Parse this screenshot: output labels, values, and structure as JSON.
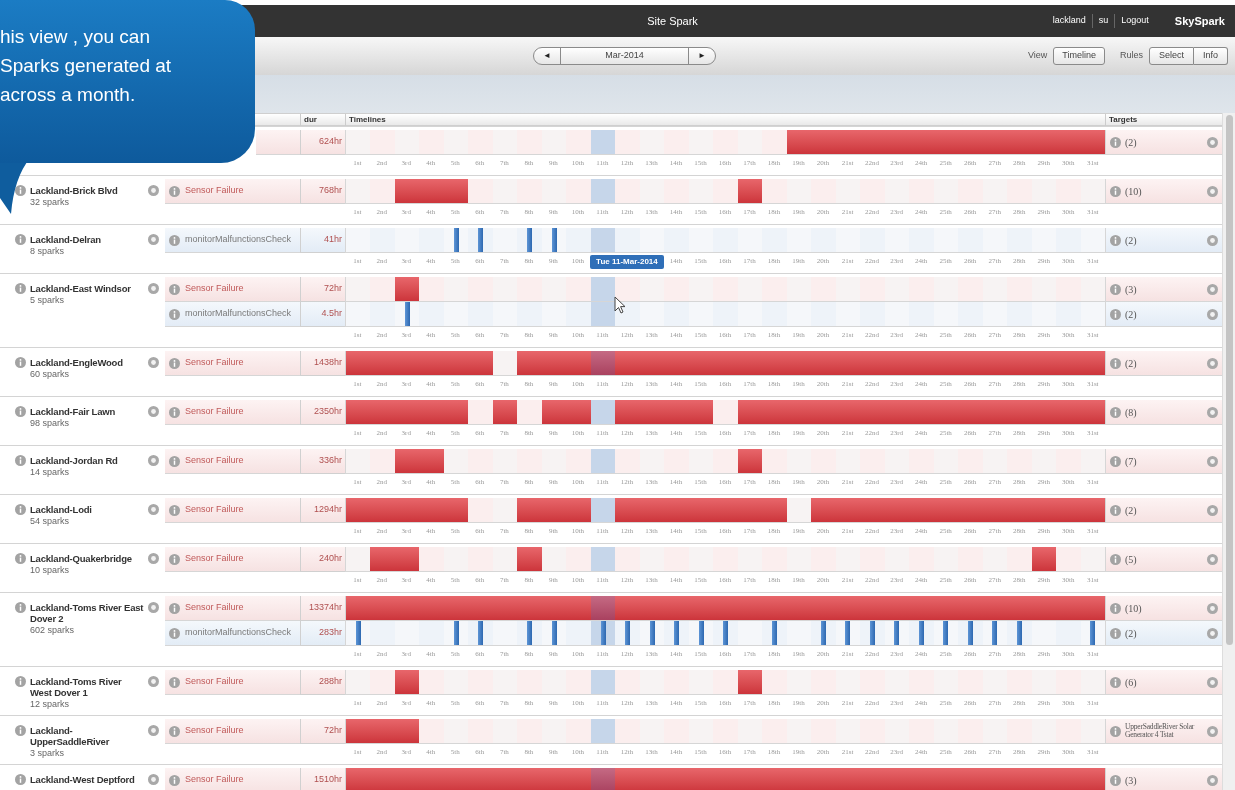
{
  "callout": {
    "lines": [
      "his view , you can",
      "Sparks generated at",
      "across a month."
    ]
  },
  "window": {
    "title": "Site Spark"
  },
  "user_links": [
    "lackland",
    "su",
    "Logout"
  ],
  "brand": "SkySpark",
  "month_nav": {
    "prev": "◄",
    "month": "Mar-2014",
    "next": "►"
  },
  "view": {
    "label": "View",
    "button": "Timeline"
  },
  "rules": {
    "label": "Rules",
    "buttons": [
      "Select",
      "Info"
    ]
  },
  "table": {
    "columns": [
      "dur",
      "Timelines",
      "Targets"
    ],
    "days": [
      {
        "selected": false
      },
      {
        "selected": false
      },
      {
        "selected": false
      },
      {
        "selected": false
      },
      {
        "selected": false
      },
      {
        "selected": false
      },
      {
        "selected": false
      },
      {
        "selected": false
      },
      {
        "selected": false
      },
      {
        "selected": false
      },
      {
        "selected": true
      },
      {
        "selected": false
      },
      {
        "selected": false
      },
      {
        "selected": false
      },
      {
        "selected": false
      },
      {
        "selected": false
      },
      {
        "selected": false
      },
      {
        "selected": false
      },
      {
        "selected": false
      },
      {
        "selected": false
      },
      {
        "selected": false
      },
      {
        "selected": false
      },
      {
        "selected": false
      },
      {
        "selected": false
      },
      {
        "selected": false
      },
      {
        "selected": false
      },
      {
        "selected": false
      },
      {
        "selected": false
      },
      {
        "selected": false
      },
      {
        "selected": false
      },
      {
        "selected": false
      }
    ],
    "groups": [
      {
        "rules": [
          {
            "kind": "failure",
            "dur": "624hr",
            "target": "(2)",
            "days": [
              false,
              false,
              false,
              false,
              false,
              false,
              false,
              false,
              false,
              false,
              false,
              false,
              false,
              false,
              false,
              false,
              false,
              false,
              true,
              true,
              true,
              true,
              true,
              true,
              true,
              true,
              true,
              true,
              true,
              true,
              true
            ]
          }
        ],
        "labels": [
          "1st",
          "2nd",
          "3rd",
          "4th",
          "5th",
          "6th",
          "7th",
          "8th",
          "9th",
          "10th",
          "11th",
          "12th",
          "13th",
          "14th",
          "15th",
          "16th",
          "17th",
          "18th",
          "19th",
          "20th",
          "21st",
          "22nd",
          "23rd",
          "24th",
          "25th",
          "26th",
          "27th",
          "28th",
          "29th",
          "30th",
          "31st"
        ]
      },
      {
        "site": {
          "name": "Lackland-Brick Blvd",
          "sparks": "32 sparks"
        },
        "rules": [
          {
            "kind": "failure",
            "name": "Sensor Failure",
            "dur": "768hr",
            "target": "(10)",
            "days": [
              false,
              false,
              true,
              true,
              true,
              false,
              false,
              false,
              false,
              false,
              false,
              false,
              false,
              false,
              false,
              false,
              true,
              false,
              false,
              false,
              false,
              false,
              false,
              false,
              false,
              false,
              false,
              false,
              false,
              false,
              false
            ]
          }
        ],
        "labels": [
          "1st",
          "2nd",
          "3rd",
          "4th",
          "5th",
          "6th",
          "7th",
          "8th",
          "9th",
          "10th",
          "11th",
          "12th",
          "13th",
          "14th",
          "15th",
          "16th",
          "17th",
          "18th",
          "19th",
          "20th",
          "21st",
          "22nd",
          "23rd",
          "24th",
          "25th",
          "26th",
          "27th",
          "28th",
          "29th",
          "30th",
          "31st"
        ]
      },
      {
        "site": {
          "name": "Lackland-Delran",
          "sparks": "8 sparks"
        },
        "rules": [
          {
            "kind": "check",
            "name": "monitorMalfunctionsCheck",
            "dur": "41hr",
            "target": "(2)",
            "days": [
              false,
              false,
              false,
              false,
              true,
              true,
              false,
              true,
              true,
              false,
              false,
              false,
              false,
              false,
              false,
              false,
              false,
              false,
              false,
              false,
              false,
              false,
              false,
              false,
              false,
              false,
              false,
              false,
              false,
              false,
              false
            ]
          }
        ],
        "labels_before": [
          "1st",
          "2nd",
          "3rd",
          "4th",
          "5th",
          "6th",
          "7th",
          "8th",
          "9th",
          "10th"
        ],
        "tooltip": "Tue 11-Mar-2014",
        "labels_after": [
          "14th",
          "15th",
          "16th",
          "17th",
          "18th",
          "19th",
          "20th",
          "21st",
          "22nd",
          "23rd",
          "24th",
          "25th",
          "26th",
          "27th",
          "28th",
          "29th",
          "30th",
          "31st"
        ]
      },
      {
        "site": {
          "name": "Lackland-East Windsor",
          "sparks": "5 sparks"
        },
        "rules": [
          {
            "kind": "failure",
            "name": "Sensor Failure",
            "dur": "72hr",
            "target": "(3)",
            "days": [
              false,
              false,
              true,
              false,
              false,
              false,
              false,
              false,
              false,
              false,
              false,
              false,
              false,
              false,
              false,
              false,
              false,
              false,
              false,
              false,
              false,
              false,
              false,
              false,
              false,
              false,
              false,
              false,
              false,
              false,
              false
            ]
          },
          {
            "kind": "check",
            "name": "monitorMalfunctionsCheck",
            "dur": "4.5hr",
            "target": "(2)",
            "days": [
              false,
              false,
              true,
              false,
              false,
              false,
              false,
              false,
              false,
              false,
              false,
              false,
              false,
              false,
              false,
              false,
              false,
              false,
              false,
              false,
              false,
              false,
              false,
              false,
              false,
              false,
              false,
              false,
              false,
              false,
              false
            ]
          }
        ],
        "labels": [
          "1st",
          "2nd",
          "3rd",
          "4th",
          "5th",
          "6th",
          "7th",
          "8th",
          "9th",
          "10th",
          "11th",
          "12th",
          "13th",
          "14th",
          "15th",
          "16th",
          "17th",
          "18th",
          "19th",
          "20th",
          "21st",
          "22nd",
          "23rd",
          "24th",
          "25th",
          "26th",
          "27th",
          "28th",
          "29th",
          "30th",
          "31st"
        ]
      },
      {
        "site": {
          "name": "Lackland-EngleWood",
          "sparks": "60 sparks"
        },
        "rules": [
          {
            "kind": "failure",
            "name": "Sensor Failure",
            "dur": "1438hr",
            "target": "(2)",
            "days": [
              true,
              true,
              true,
              true,
              true,
              true,
              false,
              true,
              true,
              true,
              true,
              true,
              true,
              true,
              true,
              true,
              true,
              true,
              true,
              true,
              true,
              true,
              true,
              true,
              true,
              true,
              true,
              true,
              true,
              true,
              true
            ]
          }
        ],
        "labels": [
          "1st",
          "2nd",
          "3rd",
          "4th",
          "5th",
          "6th",
          "7th",
          "8th",
          "9th",
          "10th",
          "11th",
          "12th",
          "13th",
          "14th",
          "15th",
          "16th",
          "17th",
          "18th",
          "19th",
          "20th",
          "21st",
          "22nd",
          "23rd",
          "24th",
          "25th",
          "26th",
          "27th",
          "28th",
          "29th",
          "30th",
          "31st"
        ]
      },
      {
        "site": {
          "name": "Lackland-Fair Lawn",
          "sparks": "98 sparks"
        },
        "rules": [
          {
            "kind": "failure",
            "name": "Sensor Failure",
            "dur": "2350hr",
            "target": "(8)",
            "days": [
              true,
              true,
              true,
              true,
              true,
              false,
              true,
              false,
              true,
              true,
              false,
              true,
              true,
              true,
              true,
              false,
              true,
              true,
              true,
              true,
              true,
              true,
              true,
              true,
              true,
              true,
              true,
              true,
              true,
              true,
              true
            ]
          }
        ],
        "labels": [
          "1st",
          "2nd",
          "3rd",
          "4th",
          "5th",
          "6th",
          "7th",
          "8th",
          "9th",
          "10th",
          "11th",
          "12th",
          "13th",
          "14th",
          "15th",
          "16th",
          "17th",
          "18th",
          "19th",
          "20th",
          "21st",
          "22nd",
          "23rd",
          "24th",
          "25th",
          "26th",
          "27th",
          "28th",
          "29th",
          "30th",
          "31st"
        ]
      },
      {
        "site": {
          "name": "Lackland-Jordan Rd",
          "sparks": "14 sparks"
        },
        "rules": [
          {
            "kind": "failure",
            "name": "Sensor Failure",
            "dur": "336hr",
            "target": "(7)",
            "days": [
              false,
              false,
              true,
              true,
              false,
              false,
              false,
              false,
              false,
              false,
              false,
              false,
              false,
              false,
              false,
              false,
              true,
              false,
              false,
              false,
              false,
              false,
              false,
              false,
              false,
              false,
              false,
              false,
              false,
              false,
              false
            ]
          }
        ],
        "labels": [
          "1st",
          "2nd",
          "3rd",
          "4th",
          "5th",
          "6th",
          "7th",
          "8th",
          "9th",
          "10th",
          "11th",
          "12th",
          "13th",
          "14th",
          "15th",
          "16th",
          "17th",
          "18th",
          "19th",
          "20th",
          "21st",
          "22nd",
          "23rd",
          "24th",
          "25th",
          "26th",
          "27th",
          "28th",
          "29th",
          "30th",
          "31st"
        ]
      },
      {
        "site": {
          "name": "Lackland-Lodi",
          "sparks": "54 sparks"
        },
        "rules": [
          {
            "kind": "failure",
            "name": "Sensor Failure",
            "dur": "1294hr",
            "target": "(2)",
            "days": [
              true,
              true,
              true,
              true,
              true,
              false,
              false,
              true,
              true,
              true,
              false,
              true,
              true,
              true,
              true,
              true,
              true,
              true,
              false,
              true,
              true,
              true,
              true,
              true,
              true,
              true,
              true,
              true,
              true,
              true,
              true
            ]
          }
        ],
        "labels": [
          "1st",
          "2nd",
          "3rd",
          "4th",
          "5th",
          "6th",
          "7th",
          "8th",
          "9th",
          "10th",
          "11th",
          "12th",
          "13th",
          "14th",
          "15th",
          "16th",
          "17th",
          "18th",
          "19th",
          "20th",
          "21st",
          "22nd",
          "23rd",
          "24th",
          "25th",
          "26th",
          "27th",
          "28th",
          "29th",
          "30th",
          "31st"
        ]
      },
      {
        "site": {
          "name": "Lackland-Quakerbridge",
          "sparks": "10 sparks"
        },
        "rules": [
          {
            "kind": "failure",
            "name": "Sensor Failure",
            "dur": "240hr",
            "target": "(5)",
            "days": [
              false,
              true,
              true,
              false,
              false,
              false,
              false,
              true,
              false,
              false,
              false,
              false,
              false,
              false,
              false,
              false,
              false,
              false,
              false,
              false,
              false,
              false,
              false,
              false,
              false,
              false,
              false,
              false,
              true,
              false,
              false
            ]
          }
        ],
        "labels": [
          "1st",
          "2nd",
          "3rd",
          "4th",
          "5th",
          "6th",
          "7th",
          "8th",
          "9th",
          "10th",
          "11th",
          "12th",
          "13th",
          "14th",
          "15th",
          "16th",
          "17th",
          "18th",
          "19th",
          "20th",
          "21st",
          "22nd",
          "23rd",
          "24th",
          "25th",
          "26th",
          "27th",
          "28th",
          "29th",
          "30th",
          "31st"
        ]
      },
      {
        "site": {
          "name": "Lackland-Toms River East Dover 2",
          "sparks": "602 sparks"
        },
        "rules": [
          {
            "kind": "failure",
            "name": "Sensor Failure",
            "dur": "13374hr",
            "target": "(10)",
            "days": [
              true,
              true,
              true,
              true,
              true,
              true,
              true,
              true,
              true,
              true,
              true,
              true,
              true,
              true,
              true,
              true,
              true,
              true,
              true,
              true,
              true,
              true,
              true,
              true,
              true,
              true,
              true,
              true,
              true,
              true,
              true
            ]
          },
          {
            "kind": "check",
            "name": "monitorMalfunctionsCheck",
            "dur": "283hr",
            "target": "(2)",
            "days": [
              true,
              false,
              false,
              false,
              true,
              true,
              false,
              true,
              true,
              false,
              true,
              true,
              true,
              true,
              true,
              true,
              false,
              true,
              false,
              true,
              true,
              true,
              true,
              true,
              true,
              true,
              true,
              true,
              false,
              false,
              true
            ]
          }
        ],
        "labels": [
          "1st",
          "2nd",
          "3rd",
          "4th",
          "5th",
          "6th",
          "7th",
          "8th",
          "9th",
          "10th",
          "11th",
          "12th",
          "13th",
          "14th",
          "15th",
          "16th",
          "17th",
          "18th",
          "19th",
          "20th",
          "21st",
          "22nd",
          "23rd",
          "24th",
          "25th",
          "26th",
          "27th",
          "28th",
          "29th",
          "30th",
          "31st"
        ]
      },
      {
        "site": {
          "name": "Lackland-Toms River West Dover 1",
          "sparks": "12 sparks"
        },
        "rules": [
          {
            "kind": "failure",
            "name": "Sensor Failure",
            "dur": "288hr",
            "target": "(6)",
            "days": [
              false,
              false,
              true,
              false,
              false,
              false,
              false,
              false,
              false,
              false,
              false,
              false,
              false,
              false,
              false,
              false,
              true,
              false,
              false,
              false,
              false,
              false,
              false,
              false,
              false,
              false,
              false,
              false,
              false,
              false,
              false
            ]
          }
        ],
        "labels": [
          "1st",
          "2nd",
          "3rd",
          "4th",
          "5th",
          "6th",
          "7th",
          "8th",
          "9th",
          "10th",
          "11th",
          "12th",
          "13th",
          "14th",
          "15th",
          "16th",
          "17th",
          "18th",
          "19th",
          "20th",
          "21st",
          "22nd",
          "23rd",
          "24th",
          "25th",
          "26th",
          "27th",
          "28th",
          "29th",
          "30th",
          "31st"
        ]
      },
      {
        "site": {
          "name": "Lackland-UpperSaddleRiver",
          "sparks": "3 sparks"
        },
        "rules": [
          {
            "kind": "failure",
            "name": "Sensor Failure",
            "dur": "72hr",
            "target": "UpperSaddleRiver Solar Generator 4 Tstat",
            "days": [
              true,
              true,
              true,
              false,
              false,
              false,
              false,
              false,
              false,
              false,
              false,
              false,
              false,
              false,
              false,
              false,
              false,
              false,
              false,
              false,
              false,
              false,
              false,
              false,
              false,
              false,
              false,
              false,
              false,
              false,
              false
            ]
          }
        ],
        "labels": [
          "1st",
          "2nd",
          "3rd",
          "4th",
          "5th",
          "6th",
          "7th",
          "8th",
          "9th",
          "10th",
          "11th",
          "12th",
          "13th",
          "14th",
          "15th",
          "16th",
          "17th",
          "18th",
          "19th",
          "20th",
          "21st",
          "22nd",
          "23rd",
          "24th",
          "25th",
          "26th",
          "27th",
          "28th",
          "29th",
          "30th",
          "31st"
        ]
      },
      {
        "site": {
          "name": "Lackland-West Deptford"
        },
        "rules": [
          {
            "kind": "failure",
            "name": "Sensor Failure",
            "dur": "1510hr",
            "target": "(3)",
            "days": [
              true,
              true,
              true,
              true,
              true,
              true,
              true,
              true,
              true,
              true,
              true,
              true,
              true,
              true,
              true,
              true,
              true,
              true,
              true,
              true,
              true,
              true,
              true,
              true,
              true,
              true,
              true,
              true,
              true,
              true,
              true
            ]
          }
        ]
      }
    ]
  }
}
